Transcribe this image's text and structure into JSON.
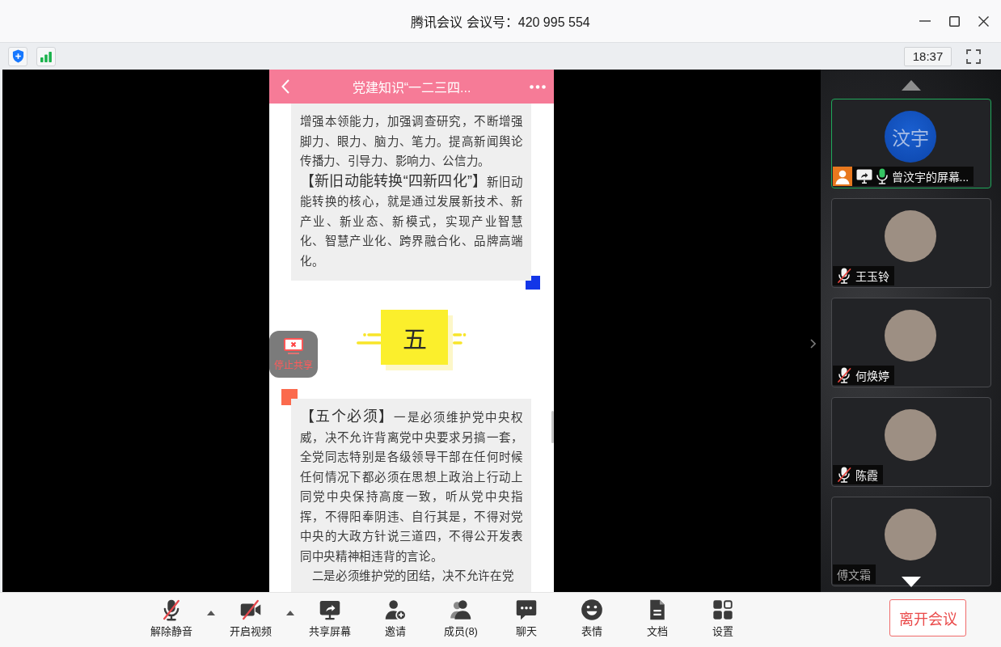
{
  "window": {
    "title": "腾讯会议 会议号：420 995 554"
  },
  "info_bar": {
    "time": "18:37"
  },
  "shared_screen": {
    "header": {
      "title": "党建知识“一二三四..."
    },
    "blocks": [
      {
        "kind": "card",
        "marker": {
          "kind": "bottom",
          "color": "#1336e8"
        },
        "paragraphs": [
          {
            "text": "增强本领能力，加强调查研究，不断增强脚力、眼力、脑力、笔力。提高新闻舆论传播力、引导力、影响力、公信力。",
            "indented": false
          },
          {
            "heading": "【新旧动能转换“四新四化”】",
            "text": "新旧动能转换的核心，就是通过发展新技术、新产业、新业态、新模式，实现产业智慧化、智慧产业化、跨界融合化、品牌高端化。",
            "indented": false
          }
        ]
      },
      {
        "kind": "section",
        "label": "五"
      },
      {
        "kind": "card",
        "marker": {
          "kind": "top",
          "color": "#fb6a4d"
        },
        "paragraphs": [
          {
            "heading": "【五个必须】",
            "text": "一是必须维护党中央权威，决不允许背离党中央要求另搞一套，全党同志特别是各级领导干部在任何时候任何情况下都必须在思想上政治上行动上同党中央保持高度一致，听从党中央指挥，不得阳奉阴违、自行其是，不得对党中央的大政方针说三道四，不得公开发表同中央精神相违背的言论。",
            "indented": false
          },
          {
            "text": "二是必须维护党的团结，决不允许在党",
            "indented": true
          }
        ]
      }
    ],
    "stop_share": {
      "label": "停止共享"
    }
  },
  "participants": [
    {
      "name": "曾汶宇的屏幕...",
      "avatar": {
        "kind": "initials",
        "text": "汶宇"
      },
      "active": true,
      "host": true,
      "sharing": true,
      "mic_shown": true,
      "muted": false,
      "dimmed": false
    },
    {
      "name": "王玉铃",
      "avatar": {
        "kind": "photo"
      },
      "active": false,
      "host": false,
      "sharing": false,
      "mic_shown": true,
      "muted": true,
      "dimmed": false
    },
    {
      "name": "何焕婷",
      "avatar": {
        "kind": "photo"
      },
      "active": false,
      "host": false,
      "sharing": false,
      "mic_shown": true,
      "muted": true,
      "dimmed": false
    },
    {
      "name": "陈霞",
      "avatar": {
        "kind": "photo"
      },
      "active": false,
      "host": false,
      "sharing": false,
      "mic_shown": true,
      "muted": true,
      "dimmed": false
    },
    {
      "name": "傅文霜",
      "avatar": {
        "kind": "photo"
      },
      "active": false,
      "host": false,
      "sharing": false,
      "mic_shown": false,
      "dimmed": true
    }
  ],
  "toolbar": {
    "items": [
      {
        "kind": "mic",
        "label": "解除静音",
        "off": true,
        "has_menu": true
      },
      {
        "kind": "camera",
        "label": "开启视频",
        "off": true,
        "has_menu": true
      },
      {
        "kind": "share",
        "label": "共享屏幕",
        "off": false,
        "has_menu": false
      },
      {
        "kind": "invite",
        "label": "邀请",
        "off": false,
        "has_menu": false
      },
      {
        "kind": "members",
        "label": "成员(8)",
        "off": false,
        "has_menu": false
      },
      {
        "kind": "chat",
        "label": "聊天",
        "off": false,
        "has_menu": false
      },
      {
        "kind": "emoji",
        "label": "表情",
        "off": false,
        "has_menu": false
      },
      {
        "kind": "document",
        "label": "文档",
        "off": false,
        "has_menu": false
      },
      {
        "kind": "settings",
        "label": "设置",
        "off": false,
        "has_menu": false
      }
    ],
    "leave_button": "离开会议"
  }
}
